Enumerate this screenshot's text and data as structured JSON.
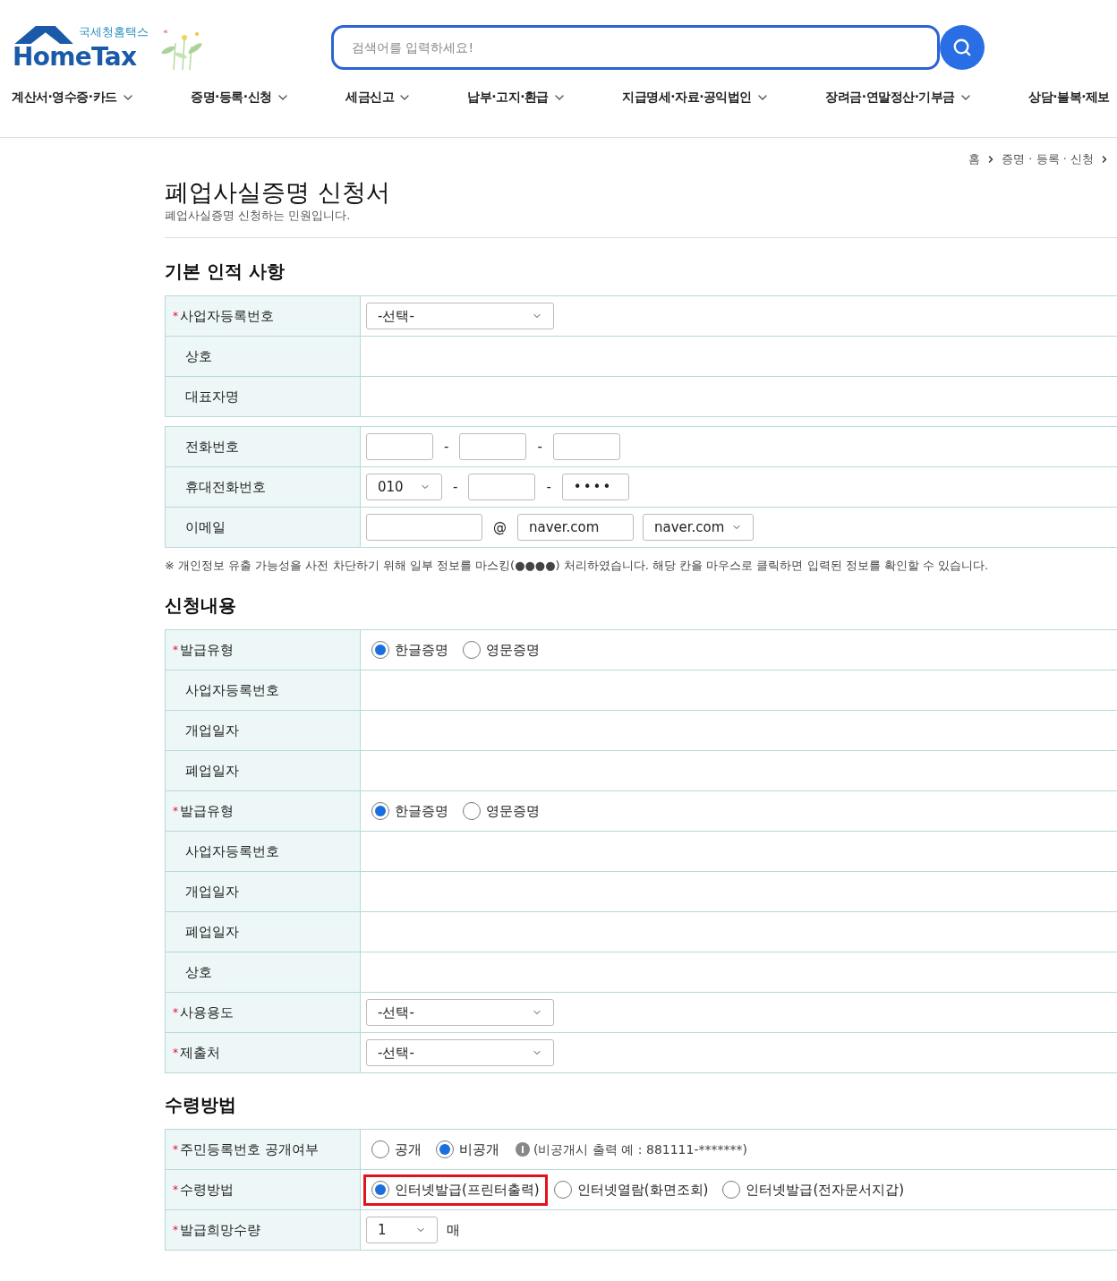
{
  "required_marker": "*",
  "header": {
    "logo_caption": "국세청홈택스",
    "logo_title": "HomeTax",
    "search": {
      "placeholder": "검색어를 입력하세요!"
    }
  },
  "nav": [
    {
      "label": "계산서·영수증·카드",
      "dropdown": true
    },
    {
      "label": "증명·등록·신청",
      "dropdown": true
    },
    {
      "label": "세금신고",
      "dropdown": true
    },
    {
      "label": "납부·고지·환급",
      "dropdown": true
    },
    {
      "label": "지급명세·자료·공익법인",
      "dropdown": true
    },
    {
      "label": "장려금·연말정산·기부금",
      "dropdown": true
    },
    {
      "label": "상담·불복·제보",
      "dropdown": false
    }
  ],
  "breadcrumb": [
    "홈",
    "증명 · 등록 · 신청"
  ],
  "page": {
    "title": "폐업사실증명 신청서",
    "subtitle": "폐업사실증명 신청하는 민원입니다."
  },
  "sections": [
    {
      "title": "기본 인적 사항",
      "tables": [
        [
          {
            "label": "사업자등록번호",
            "required": true,
            "kind": "select",
            "value": "-선택-"
          },
          {
            "label": "상호",
            "required": false,
            "kind": "text"
          },
          {
            "label": "대표자명",
            "required": false,
            "kind": "text"
          }
        ],
        [
          {
            "label": "전화번호",
            "required": false,
            "kind": "phone",
            "parts": [
              {
                "kind": "input"
              },
              {
                "kind": "sep",
                "text": "-"
              },
              {
                "kind": "input"
              },
              {
                "kind": "sep",
                "text": "-"
              },
              {
                "kind": "input"
              }
            ]
          },
          {
            "label": "휴대전화번호",
            "required": false,
            "kind": "phone",
            "parts": [
              {
                "kind": "select",
                "value": "010"
              },
              {
                "kind": "sep",
                "text": "-"
              },
              {
                "kind": "input"
              },
              {
                "kind": "sep",
                "text": "-"
              },
              {
                "kind": "input",
                "value": "••••"
              }
            ]
          },
          {
            "label": "이메일",
            "required": false,
            "kind": "email",
            "parts": [
              {
                "kind": "input"
              },
              {
                "kind": "sep",
                "text": "@"
              },
              {
                "kind": "input",
                "value": "naver.com"
              },
              {
                "kind": "select",
                "value": "naver.com"
              }
            ]
          }
        ]
      ],
      "note": "※ 개인정보 유출 가능성을 사전 차단하기 위해 일부 정보를 마스킹(●●●●) 처리하였습니다. 해당 칸을 마우스로 클릭하면 입력된 정보를 확인할 수 있습니다."
    },
    {
      "title": "신청내용",
      "tables": [
        [
          {
            "label": "발급유형",
            "required": true,
            "kind": "radio",
            "options": [
              {
                "label": "한글증명",
                "selected": true,
                "highlighted": false
              },
              {
                "label": "영문증명",
                "selected": false,
                "highlighted": false
              }
            ]
          },
          {
            "label": "사업자등록번호",
            "required": false,
            "kind": "text"
          },
          {
            "label": "개업일자",
            "required": false,
            "kind": "text"
          },
          {
            "label": "폐업일자",
            "required": false,
            "kind": "text"
          },
          {
            "label": "발급유형",
            "required": true,
            "kind": "radio",
            "options": [
              {
                "label": "한글증명",
                "selected": true,
                "highlighted": false
              },
              {
                "label": "영문증명",
                "selected": false,
                "highlighted": false
              }
            ]
          },
          {
            "label": "사업자등록번호",
            "required": false,
            "kind": "text"
          },
          {
            "label": "개업일자",
            "required": false,
            "kind": "text"
          },
          {
            "label": "폐업일자",
            "required": false,
            "kind": "text"
          },
          {
            "label": "상호",
            "required": false,
            "kind": "text"
          },
          {
            "label": "사용용도",
            "required": true,
            "kind": "select",
            "value": "-선택-"
          },
          {
            "label": "제출처",
            "required": true,
            "kind": "select",
            "value": "-선택-"
          }
        ]
      ]
    },
    {
      "title": "수령방법",
      "tables": [
        [
          {
            "label": "주민등록번호 공개여부",
            "required": true,
            "kind": "radio",
            "options": [
              {
                "label": "공개",
                "selected": false,
                "highlighted": false
              },
              {
                "label": "비공개",
                "selected": true,
                "highlighted": false
              }
            ],
            "info": "(비공개시 출력 예 : 881111-*******)"
          },
          {
            "label": "수령방법",
            "required": true,
            "kind": "radio",
            "options": [
              {
                "label": "인터넷발급(프린터출력)",
                "selected": true,
                "highlighted": true
              },
              {
                "label": "인터넷열람(화면조회)",
                "selected": false,
                "highlighted": false
              },
              {
                "label": "인터넷발급(전자문서지갑)",
                "selected": false,
                "highlighted": false
              }
            ]
          },
          {
            "label": "발급희망수량",
            "required": true,
            "kind": "quantity",
            "value": "1",
            "unit": "매"
          }
        ]
      ]
    }
  ]
}
